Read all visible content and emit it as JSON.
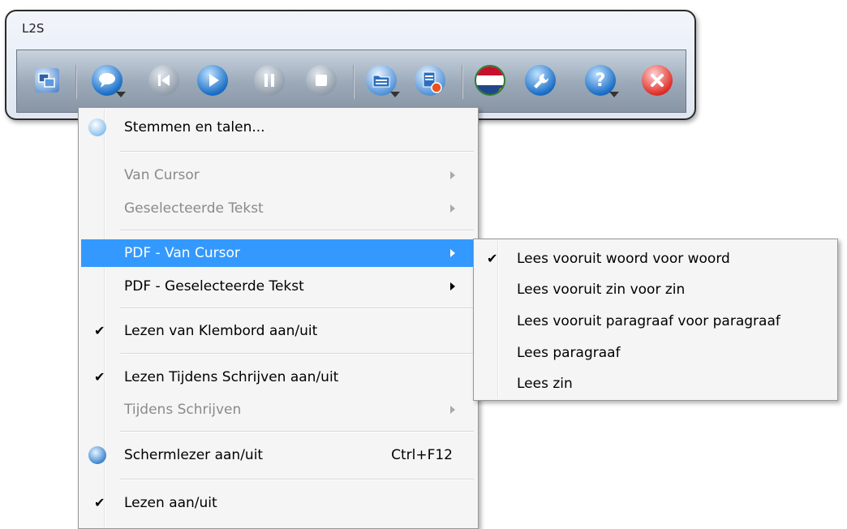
{
  "window": {
    "title": "L2S"
  },
  "toolbar": {
    "buttons": [
      {
        "icon": "tile-windows-icon"
      },
      {
        "icon": "speech-bubble-icon"
      },
      {
        "icon": "skip-back-icon"
      },
      {
        "icon": "play-icon"
      },
      {
        "icon": "pause-icon"
      },
      {
        "icon": "stop-icon"
      },
      {
        "icon": "document-open-icon"
      },
      {
        "icon": "record-icon"
      },
      {
        "icon": "netherlands-flag-icon"
      },
      {
        "icon": "settings-wrench-icon"
      },
      {
        "icon": "help-icon"
      },
      {
        "icon": "close-icon"
      }
    ]
  },
  "menu": {
    "items": [
      {
        "label": "Stemmen en talen...",
        "icon": "voices-icon"
      },
      {
        "label": "Van Cursor",
        "disabled": true,
        "submenu": true
      },
      {
        "label": "Geselecteerde Tekst",
        "disabled": true,
        "submenu": true
      },
      {
        "label": "PDF - Van Cursor",
        "submenu": true,
        "highlighted": true
      },
      {
        "label": "PDF - Geselecteerde Tekst",
        "submenu": true
      },
      {
        "label": "Lezen van Klembord aan/uit",
        "checked": true
      },
      {
        "label": "Lezen Tijdens Schrijven aan/uit",
        "checked": true
      },
      {
        "label": "Tijdens Schrijven",
        "disabled": true,
        "submenu": true
      },
      {
        "label": "Schermlezer aan/uit",
        "shortcut": "Ctrl+F12",
        "icon": "screenreader-icon"
      },
      {
        "label": "Lezen aan/uit",
        "checked": true
      }
    ],
    "check_glyph": "✔"
  },
  "submenu": {
    "items": [
      {
        "label": "Lees vooruit woord voor woord",
        "checked": true
      },
      {
        "label": "Lees vooruit zin voor zin"
      },
      {
        "label": "Lees vooruit paragraaf voor paragraaf"
      },
      {
        "label": "Lees paragraaf"
      },
      {
        "label": "Lees zin"
      }
    ]
  },
  "colors": {
    "highlight": "#3399ff",
    "disabled_text": "#8a8a8a"
  }
}
